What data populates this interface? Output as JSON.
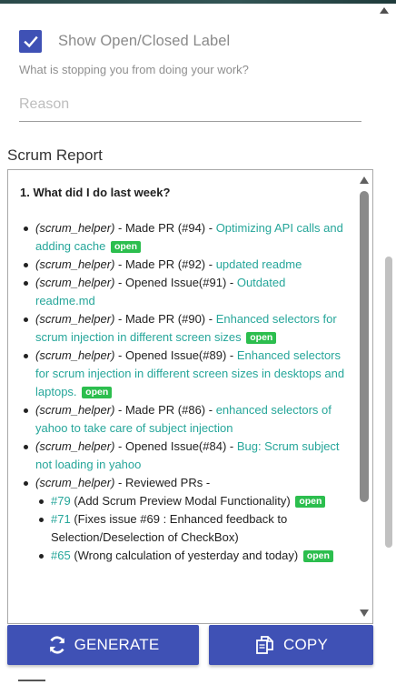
{
  "settings": {
    "show_label_text": "Show Open/Closed Label",
    "show_label_checked": true,
    "blocker_question": "What is stopping you from doing your work?",
    "reason_placeholder": "Reason",
    "reason_value": ""
  },
  "report": {
    "section_title": "Scrum Report",
    "heading": "1. What did I do last week?",
    "badge_text": "open",
    "items": [
      {
        "prefix": "(scrum_helper)",
        "action": " - Made PR (#94) - ",
        "title": "Optimizing API calls and adding cache",
        "badge": true
      },
      {
        "prefix": "(scrum_helper)",
        "action": " - Made PR (#92) - ",
        "title": "updated readme",
        "badge": false
      },
      {
        "prefix": "(scrum_helper)",
        "action": " - Opened Issue(#91) - ",
        "title": "Outdated readme.md",
        "badge": false
      },
      {
        "prefix": "(scrum_helper)",
        "action": " - Made PR (#90) - ",
        "title": "Enhanced selectors for scrum injection in different screen sizes",
        "badge": true
      },
      {
        "prefix": "(scrum_helper)",
        "action": " - Opened Issue(#89) - ",
        "title": "Enhanced selectors for scrum injection in different screen sizes in desktops and laptops.",
        "badge": true
      },
      {
        "prefix": "(scrum_helper)",
        "action": " - Made PR (#86) - ",
        "title": "enhanced selectors of yahoo to take care of subject injection",
        "badge": false
      },
      {
        "prefix": "(scrum_helper)",
        "action": " - Opened Issue(#84) - ",
        "title": "Bug: Scrum subject not loading in yahoo",
        "badge": false
      }
    ],
    "reviewed": {
      "prefix": "(scrum_helper)",
      "action": " - Reviewed PRs -",
      "items": [
        {
          "number": "#79",
          "desc": " (Add Scrum Preview Modal Functionality)",
          "badge": true
        },
        {
          "number": "#71",
          "desc": " (Fixes issue #69 : Enhanced feedback to Selection/Deselection of CheckBox)",
          "badge": false
        },
        {
          "number": "#65",
          "desc": " (Wrong calculation of yesterday and today)",
          "badge": true
        }
      ]
    }
  },
  "buttons": {
    "generate_label": "GENERATE",
    "copy_label": "COPY"
  },
  "colors": {
    "primary": "#3f51b5",
    "link": "#26a69a",
    "badge": "#2cbe4e"
  },
  "icons": [
    "check-icon",
    "refresh-icon",
    "copy-icon"
  ]
}
